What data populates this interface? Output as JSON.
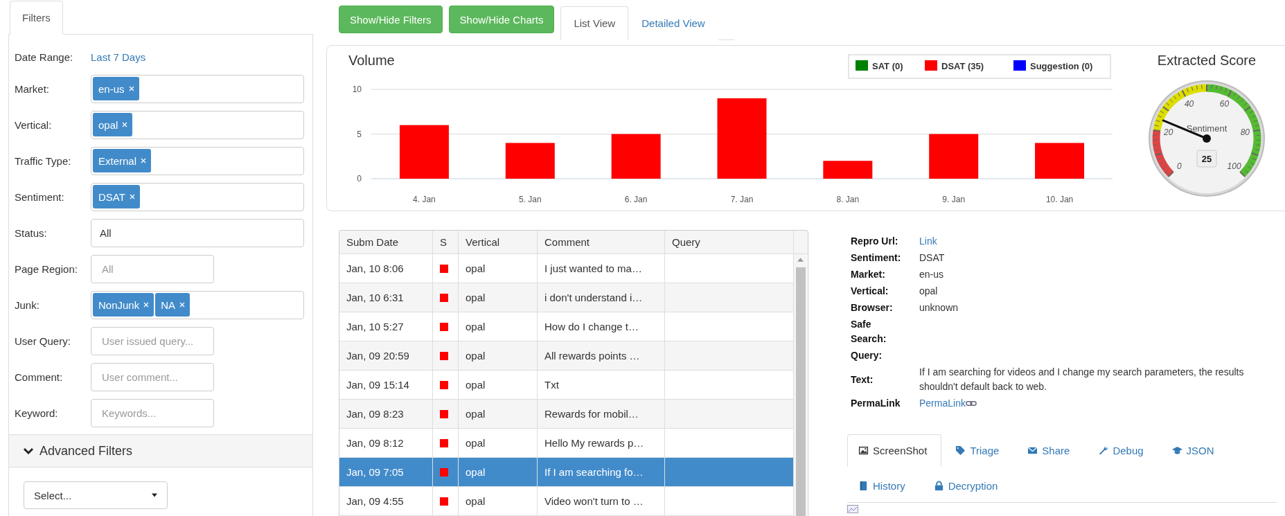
{
  "filters_tab": {
    "label": "Filters",
    "selected": true
  },
  "filters": [
    {
      "label": "Date Range:",
      "kind": "link",
      "value": "Last 7 Days"
    },
    {
      "label": "Market:",
      "kind": "tags",
      "tags": [
        "en-us"
      ]
    },
    {
      "label": "Vertical:",
      "kind": "tags",
      "tags": [
        "opal"
      ]
    },
    {
      "label": "Traffic Type:",
      "kind": "tags",
      "tags": [
        "External"
      ]
    },
    {
      "label": "Sentiment:",
      "kind": "tags",
      "tags": [
        "DSAT"
      ]
    },
    {
      "label": "Status:",
      "kind": "select",
      "value": "All"
    },
    {
      "label": "Page Region:",
      "kind": "input",
      "placeholder": "All"
    },
    {
      "label": "Junk:",
      "kind": "tags",
      "tags": [
        "NonJunk",
        "NA"
      ]
    },
    {
      "label": "User Query:",
      "kind": "input",
      "placeholder": "User issued query..."
    },
    {
      "label": "Comment:",
      "kind": "input",
      "placeholder": "User comment..."
    },
    {
      "label": "Keyword:",
      "kind": "input",
      "placeholder": "Keywords..."
    }
  ],
  "advanced": {
    "label": "Advanced Filters",
    "expanded": true,
    "select": "Select..."
  },
  "buttons": [
    "Show/Hide Filters",
    "Show/Hide Charts"
  ],
  "view_tabs": [
    {
      "label": "List View",
      "selected": true
    },
    {
      "label": "Detailed View",
      "selected": false
    }
  ],
  "volume": {
    "chart_data": {
      "type": "bar",
      "title": "Volume",
      "categories": [
        "4. Jan",
        "5. Jan",
        "6. Jan",
        "7. Jan",
        "8. Jan",
        "9. Jan",
        "10. Jan"
      ],
      "stacked": true,
      "ylim": [
        0,
        10
      ],
      "yticks": [
        0,
        5,
        10
      ],
      "series": [
        {
          "name": "SAT (0)",
          "color": "#008000",
          "values": [
            0,
            0,
            0,
            0,
            0,
            0,
            0
          ]
        },
        {
          "name": "DSAT (35)",
          "color": "#ff0000",
          "values": [
            6,
            4,
            5,
            9,
            2,
            5,
            4
          ]
        },
        {
          "name": "Suggestion (0)",
          "color": "#0000ff",
          "values": [
            0,
            0,
            0,
            0,
            0,
            0,
            0
          ]
        }
      ]
    }
  },
  "gauge": {
    "title": "Extracted Score",
    "label": "Sentiment",
    "reading": "25",
    "ticks": [
      "0",
      "20",
      "40",
      "60",
      "80",
      "100"
    ]
  },
  "table": {
    "columns": [
      "Subm Date",
      "S",
      "Vertical",
      "Comment",
      "Query"
    ],
    "rows": [
      {
        "date": "Jan, 10 8:06",
        "color": "#ff0000",
        "vertical": "opal",
        "comment": "I just wanted to ma…",
        "selected": false
      },
      {
        "date": "Jan, 10 6:31",
        "color": "#ff0000",
        "vertical": "opal",
        "comment": "i don't understand i…",
        "selected": false
      },
      {
        "date": "Jan, 10 5:27",
        "color": "#ff0000",
        "vertical": "opal",
        "comment": "How do I change t…",
        "selected": false
      },
      {
        "date": "Jan, 09 20:59",
        "color": "#ff0000",
        "vertical": "opal",
        "comment": "All rewards points …",
        "selected": false
      },
      {
        "date": "Jan, 09 15:14",
        "color": "#ff0000",
        "vertical": "opal",
        "comment": "Txt",
        "selected": false
      },
      {
        "date": "Jan, 09 8:23",
        "color": "#ff0000",
        "vertical": "opal",
        "comment": "Rewards for mobil…",
        "selected": false
      },
      {
        "date": "Jan, 09 8:12",
        "color": "#ff0000",
        "vertical": "opal",
        "comment": "Hello My rewards p…",
        "selected": false
      },
      {
        "date": "Jan, 09 7:05",
        "color": "#ff0000",
        "vertical": "opal",
        "comment": "If I am searching fo…",
        "selected": true
      },
      {
        "date": "Jan, 09 4:55",
        "color": "#ff0000",
        "vertical": "opal",
        "comment": "Video won't turn to …",
        "selected": false
      }
    ]
  },
  "details": [
    {
      "label": "Repro Url:",
      "kind": "link",
      "value": "Link"
    },
    {
      "label": "Sentiment:",
      "kind": "text",
      "value": "DSAT"
    },
    {
      "label": "Market:",
      "kind": "text",
      "value": "en-us"
    },
    {
      "label": "Vertical:",
      "kind": "text",
      "value": "opal"
    },
    {
      "label": "Browser:",
      "kind": "text",
      "value": "unknown"
    },
    {
      "label": "Safe Search:",
      "kind": "empty"
    },
    {
      "label": "Query:",
      "kind": "empty"
    },
    {
      "label": "Text:",
      "kind": "text",
      "value": "If I am searching for videos and I change my search parameters, the results shouldn't default back to web."
    },
    {
      "label": "PermaLink",
      "kind": "permalink",
      "value": "PermaLink"
    }
  ],
  "detail_tabs": [
    {
      "label": "ScreenShot",
      "selected": true
    },
    {
      "label": "Triage",
      "selected": false
    },
    {
      "label": "Share",
      "selected": false
    },
    {
      "label": "Debug",
      "selected": false
    },
    {
      "label": "JSON",
      "selected": false
    },
    {
      "label": "History",
      "selected": false
    },
    {
      "label": "Decryption",
      "selected": false
    }
  ]
}
